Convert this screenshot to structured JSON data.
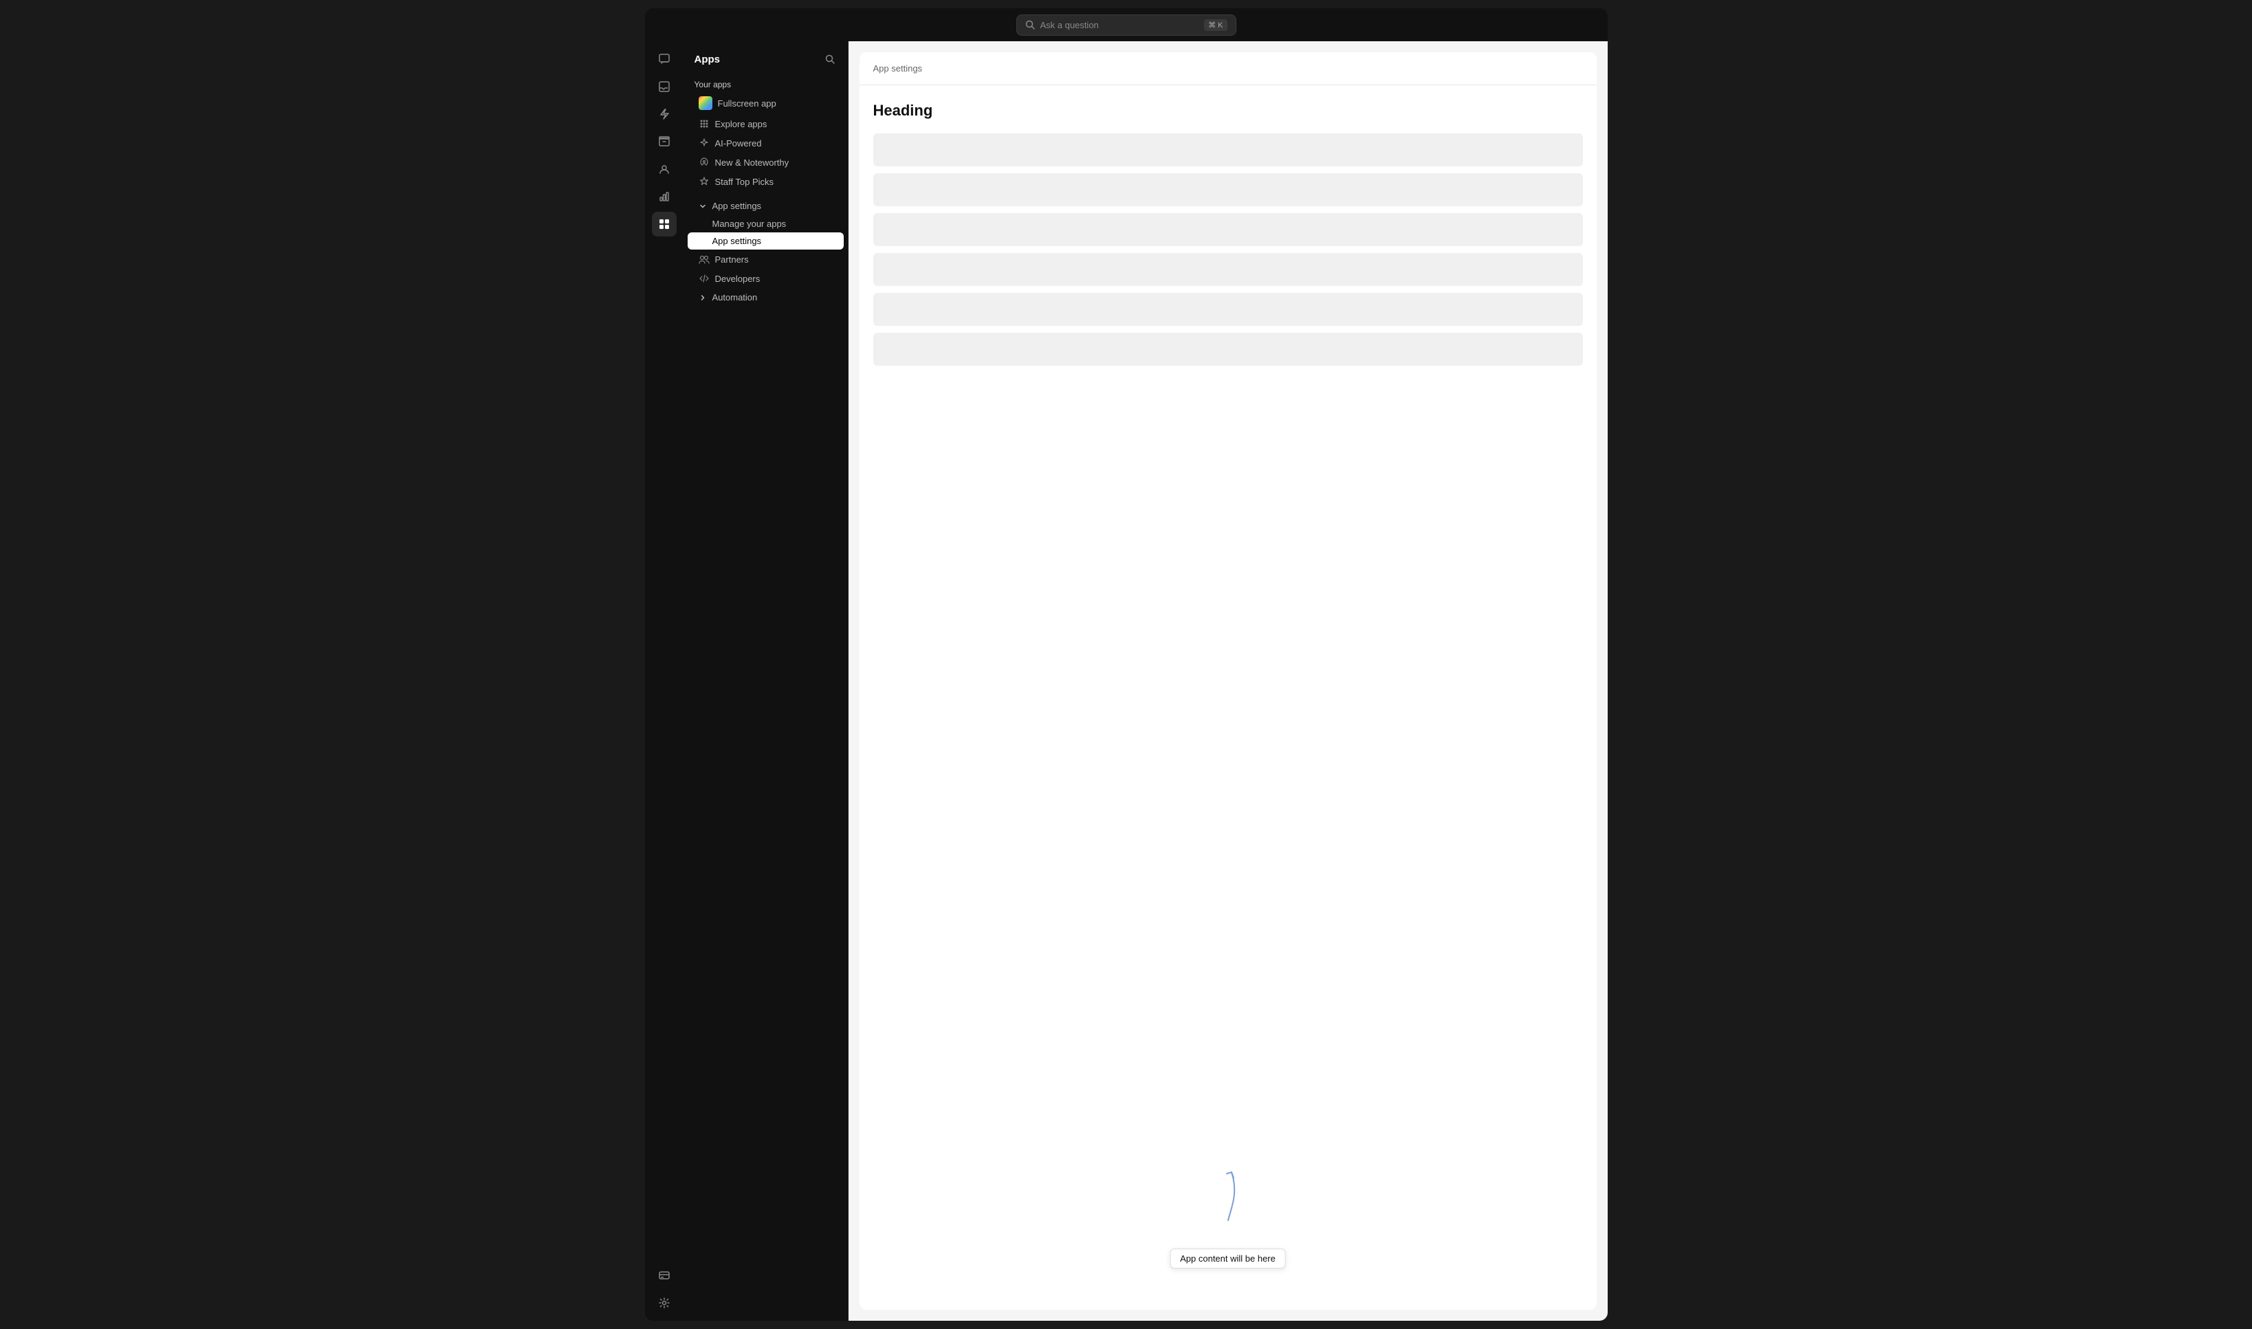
{
  "topbar": {
    "search_placeholder": "Ask a question",
    "search_shortcut": "⌘ K"
  },
  "sidebar": {
    "title": "Apps",
    "your_apps_label": "Your apps",
    "fullscreen_app_label": "Fullscreen app",
    "explore_apps_label": "Explore apps",
    "ai_powered_label": "AI-Powered",
    "new_noteworthy_label": "New & Noteworthy",
    "staff_top_picks_label": "Staff Top Picks",
    "app_settings_group_label": "App settings",
    "manage_your_apps_label": "Manage your apps",
    "app_settings_sub_label": "App settings",
    "partners_label": "Partners",
    "developers_label": "Developers",
    "automation_label": "Automation"
  },
  "rail": {
    "icons": [
      {
        "name": "chat-icon",
        "symbol": "💬"
      },
      {
        "name": "inbox-icon",
        "symbol": "📥"
      },
      {
        "name": "lightning-icon",
        "symbol": "⚡"
      },
      {
        "name": "archive-icon",
        "symbol": "🗂"
      },
      {
        "name": "contacts-icon",
        "symbol": "👥"
      },
      {
        "name": "chart-icon",
        "symbol": "📊"
      },
      {
        "name": "apps-icon",
        "symbol": "⊞"
      }
    ],
    "bottom_icons": [
      {
        "name": "billing-icon",
        "symbol": "💳"
      },
      {
        "name": "settings-icon",
        "symbol": "⚙"
      }
    ]
  },
  "content": {
    "header_label": "App settings",
    "heading": "Heading",
    "skeleton_rows": [
      1,
      2,
      3,
      4,
      5,
      6
    ],
    "annotation_label": "App content will be here"
  }
}
